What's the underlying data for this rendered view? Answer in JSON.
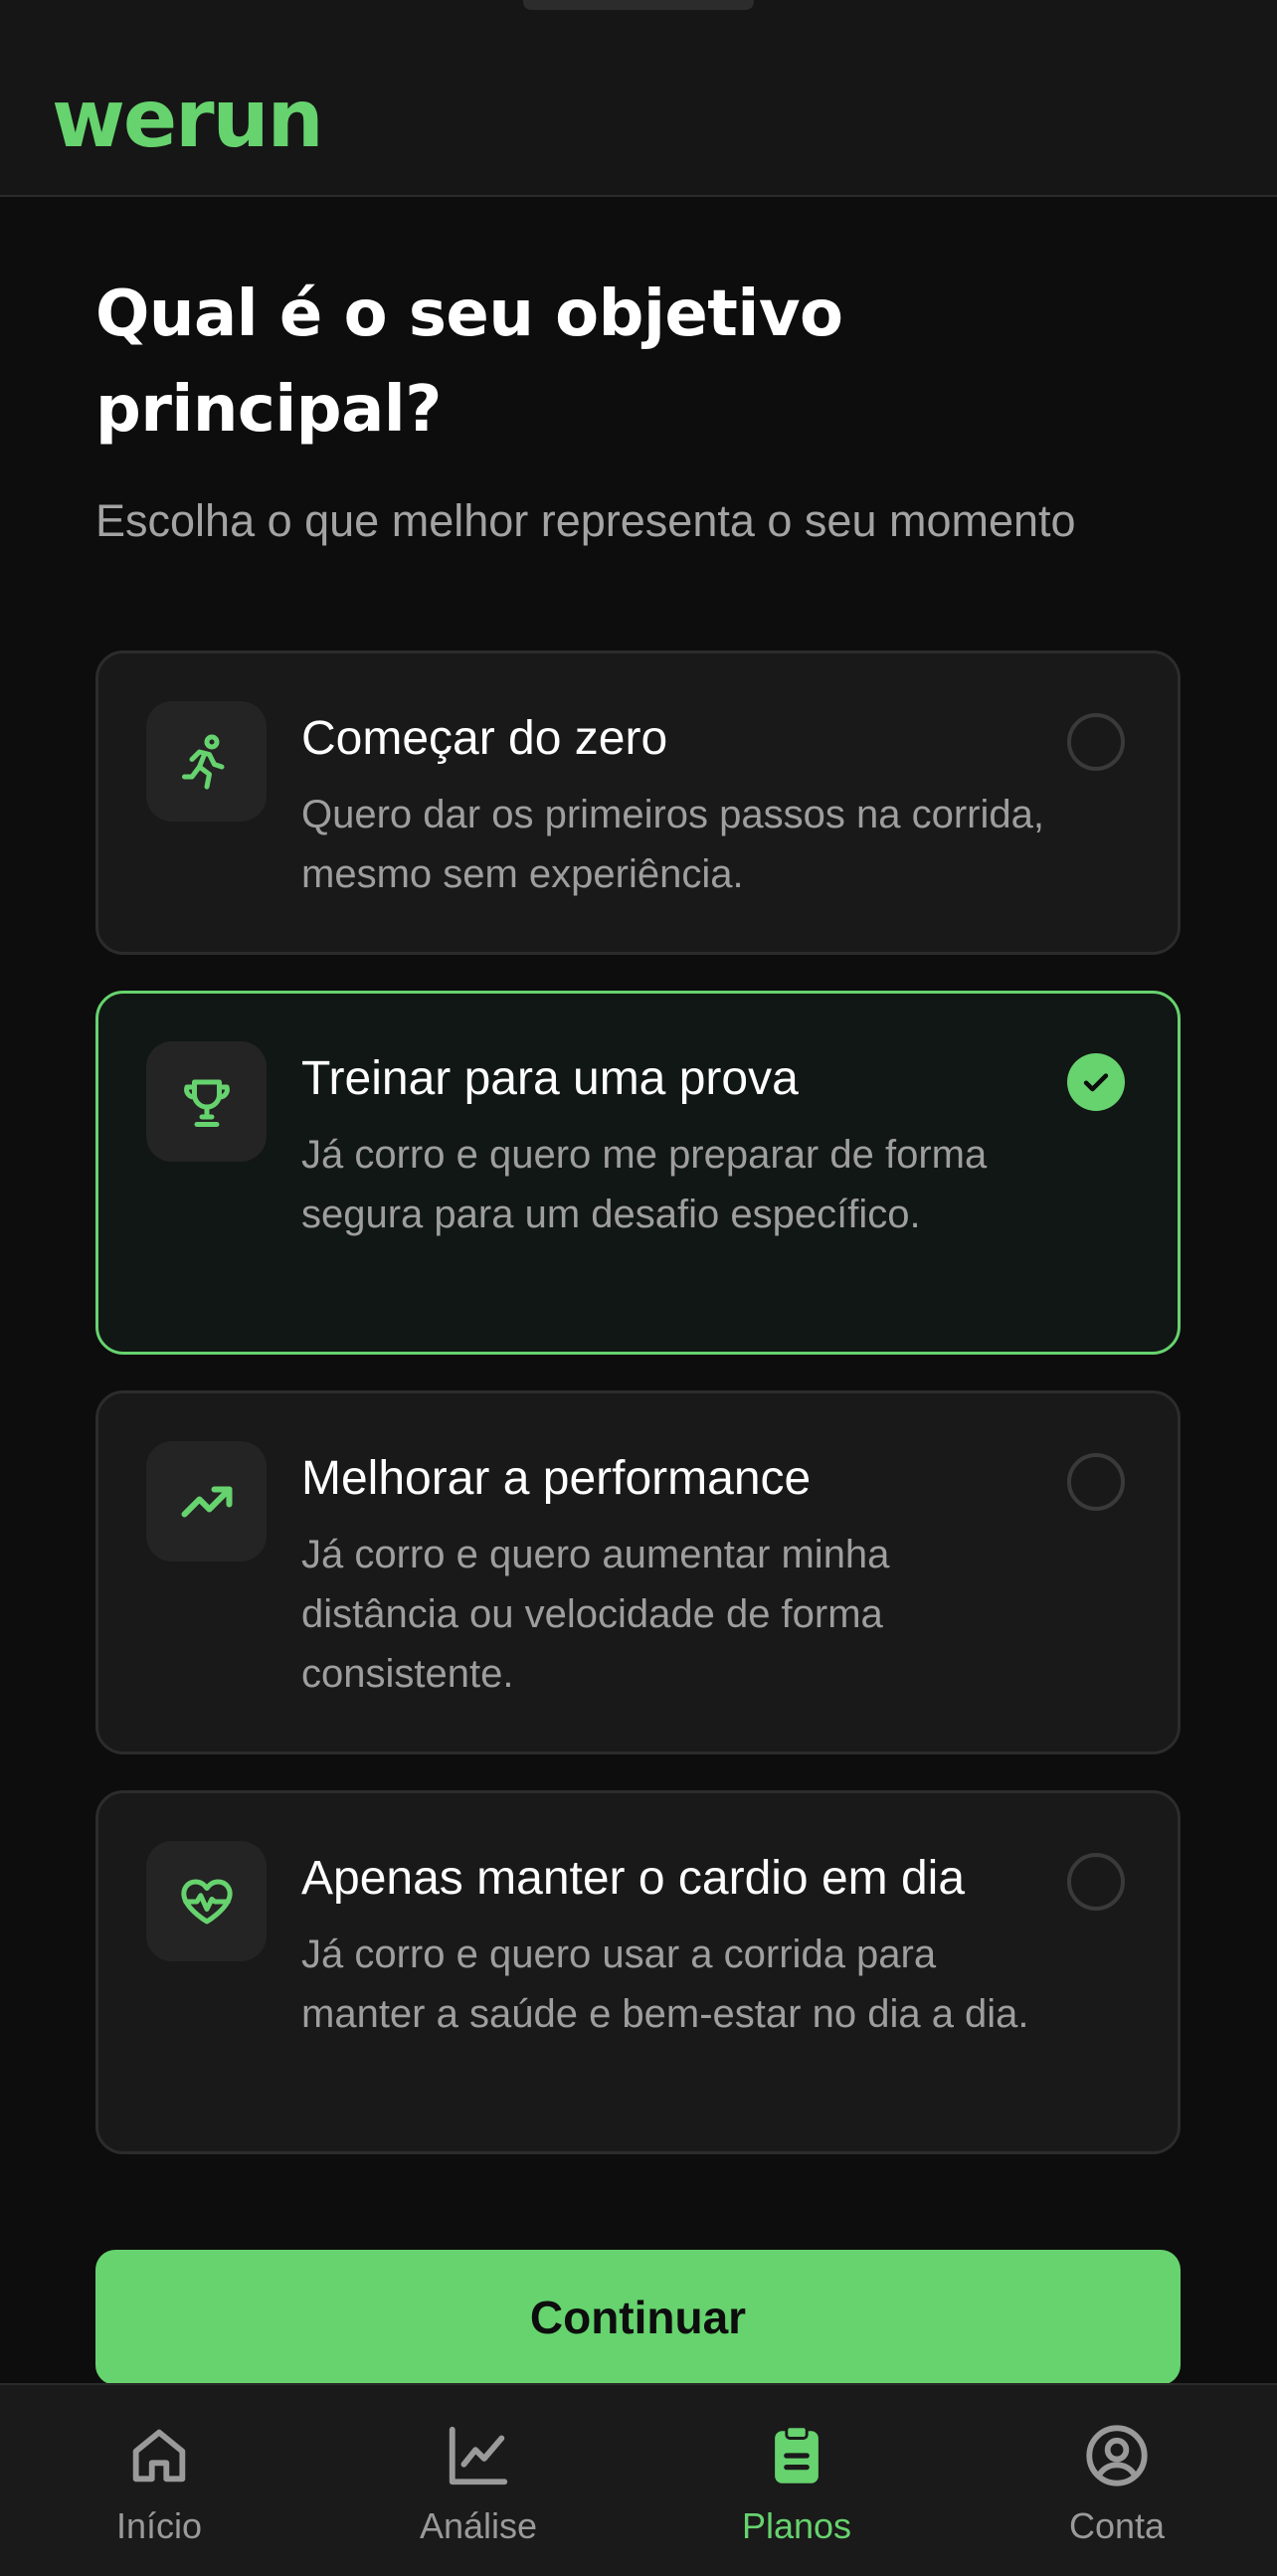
{
  "app": {
    "logo_text": "werun",
    "accent_color": "#66d36e"
  },
  "header": {
    "title": "Qual é o seu objetivo principal?",
    "subtitle": "Escolha o que melhor representa o seu momento"
  },
  "options": [
    {
      "icon": "running-person-icon",
      "title": "Começar do zero",
      "description": "Quero dar os primeiros passos na corrida, mesmo sem experiência.",
      "selected": false
    },
    {
      "icon": "trophy-icon",
      "title": "Treinar para uma prova",
      "description": "Já corro e quero me preparar de forma segura para um desafio específico.",
      "selected": true
    },
    {
      "icon": "trending-up-icon",
      "title": "Melhorar a performance",
      "description": "Já corro e quero aumentar minha distância ou velocidade de forma consistente.",
      "selected": false
    },
    {
      "icon": "heart-pulse-icon",
      "title": "Apenas manter o cardio em dia",
      "description": "Já corro e quero usar a corrida para manter a saúde e bem-estar no dia a dia.",
      "selected": false
    }
  ],
  "actions": {
    "continue_label": "Continuar"
  },
  "bottom_nav": [
    {
      "label": "Início",
      "icon": "home-icon",
      "active": false
    },
    {
      "label": "Análise",
      "icon": "chart-icon",
      "active": false
    },
    {
      "label": "Planos",
      "icon": "clipboard-icon",
      "active": true
    },
    {
      "label": "Conta",
      "icon": "user-circle-icon",
      "active": false
    }
  ]
}
